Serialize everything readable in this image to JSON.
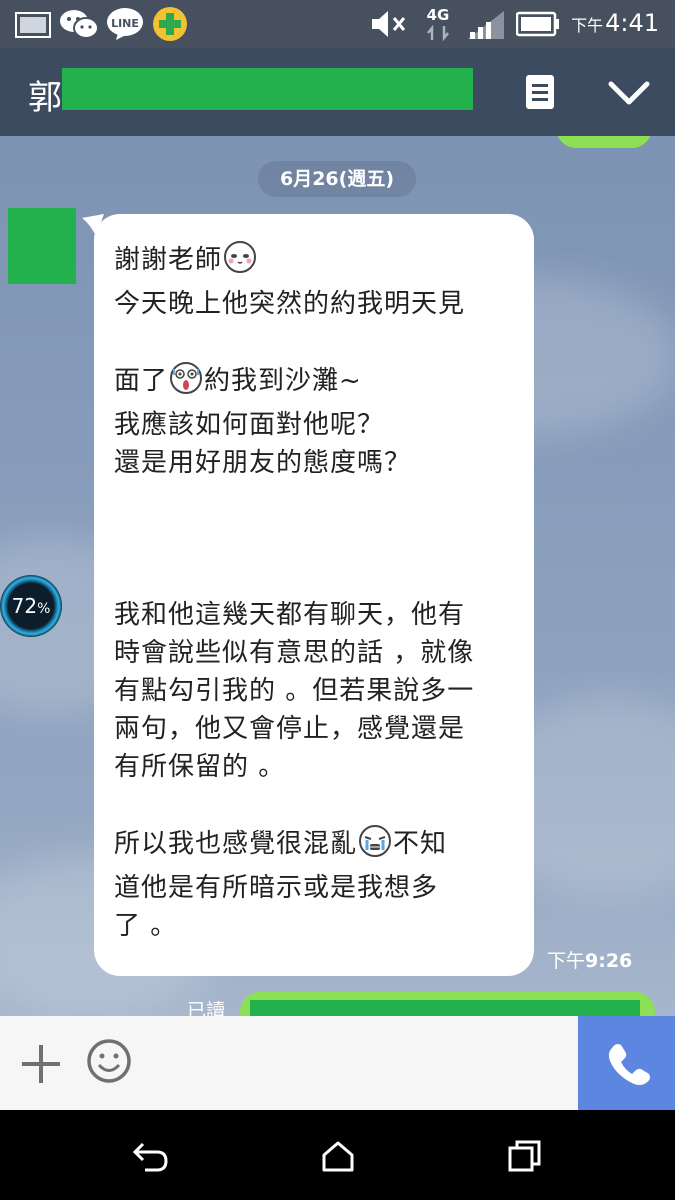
{
  "status_bar": {
    "time_prefix": "下午",
    "time": "4:41",
    "network": "4G",
    "icons": [
      "gallery-icon",
      "wechat-icon",
      "line-icon",
      "plus-app-icon",
      "mute-icon",
      "network-4g-icon",
      "signal-icon",
      "battery-icon"
    ]
  },
  "header": {
    "contact_initial": "郭",
    "contact_name_redacted": true
  },
  "chat": {
    "date_label": "6月26(週五)",
    "message": {
      "paragraphs": [
        [
          "謝謝老師",
          "{emoji:blush}"
        ],
        [
          "今天晚上他突然的約我明天見"
        ],
        [
          ""
        ],
        [
          "面了",
          "{emoji:shocked}",
          "約我到沙灘~"
        ],
        [
          "我應該如何面對他呢？"
        ],
        [
          "還是用好朋友的態度嗎？"
        ],
        [
          ""
        ],
        [
          ""
        ],
        [
          ""
        ],
        [
          "我和他這幾天都有聊天，他有"
        ],
        [
          "時會說些似有意思的話 ，就像"
        ],
        [
          "有點勾引我的 。但若果說多一"
        ],
        [
          "兩句，他又會停止，感覺還是"
        ],
        [
          "有所保留的 。"
        ],
        [
          ""
        ],
        [
          "所以我也感覺很混亂",
          "{emoji:crying}",
          "不知"
        ],
        [
          "道他是有所暗示或是我想多"
        ],
        [
          "了 。"
        ]
      ],
      "time_prefix": "下午",
      "time": "9:26"
    },
    "read_label": "已讀"
  },
  "battery_widget": {
    "percent": "72",
    "unit": "%"
  },
  "input_bar": {
    "icons": [
      "plus-icon",
      "emoji-icon",
      "phone-icon"
    ]
  },
  "nav_bar": {
    "icons": [
      "back-icon",
      "home-icon",
      "recents-icon"
    ]
  },
  "colors": {
    "status_bar": "#46505e",
    "header": "#3d4b61",
    "redaction": "#22b14c",
    "sent_bubble": "#8de055",
    "call_button": "#5d86e0"
  }
}
